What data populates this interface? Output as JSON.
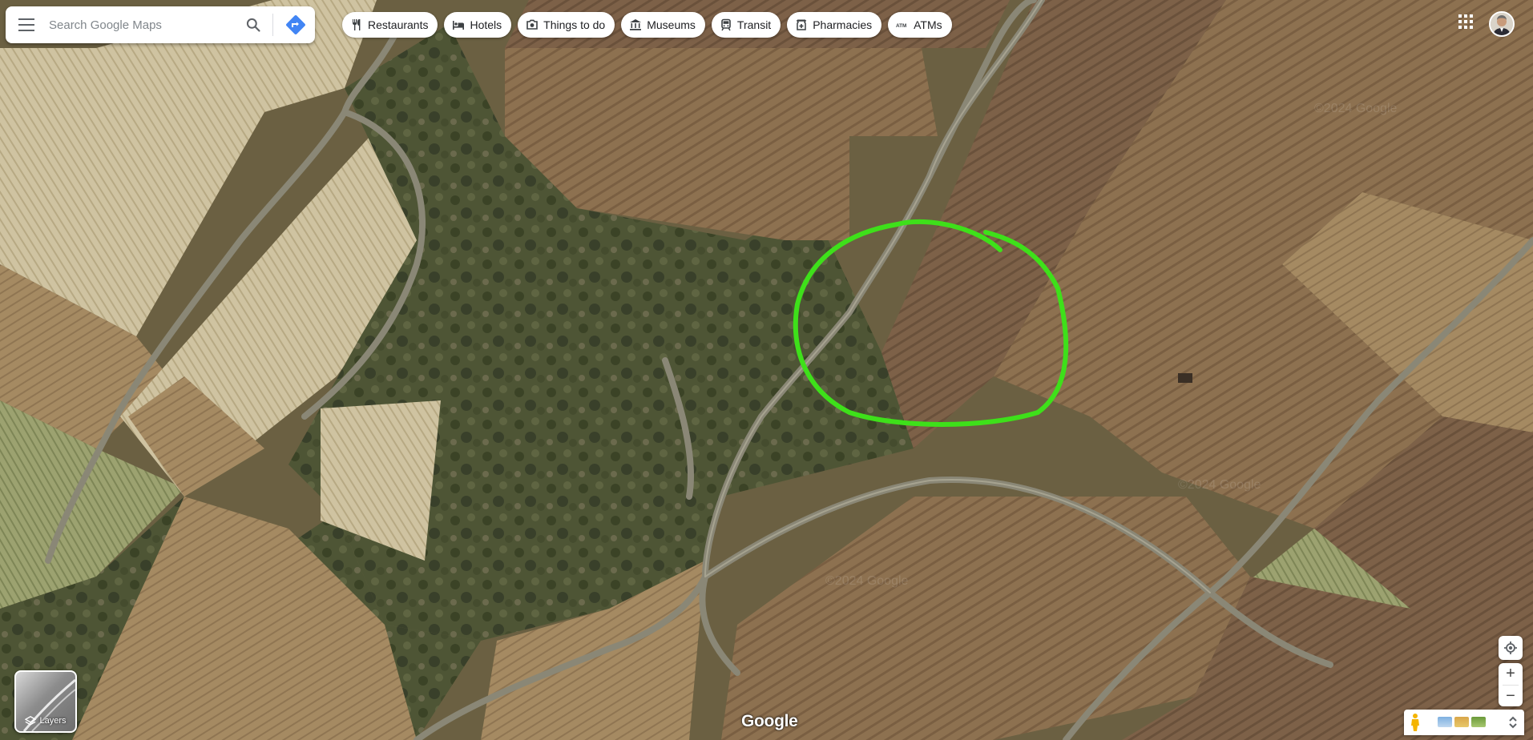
{
  "search": {
    "placeholder": "Search Google Maps"
  },
  "chips": [
    {
      "label": "Restaurants",
      "icon": "fork-knife-icon"
    },
    {
      "label": "Hotels",
      "icon": "bed-icon"
    },
    {
      "label": "Things to do",
      "icon": "camera-icon"
    },
    {
      "label": "Museums",
      "icon": "museum-icon"
    },
    {
      "label": "Transit",
      "icon": "train-icon"
    },
    {
      "label": "Pharmacies",
      "icon": "pharmacy-icon"
    },
    {
      "label": "ATMs",
      "icon": "atm-icon"
    }
  ],
  "layers": {
    "label": "Layers"
  },
  "brand": {
    "logo": "Google"
  },
  "zoom": {
    "in": "+",
    "out": "−"
  },
  "colors": {
    "annotation": "#3ee01a",
    "directions": "#4285f4"
  },
  "map_watermark": "©2024 Google"
}
